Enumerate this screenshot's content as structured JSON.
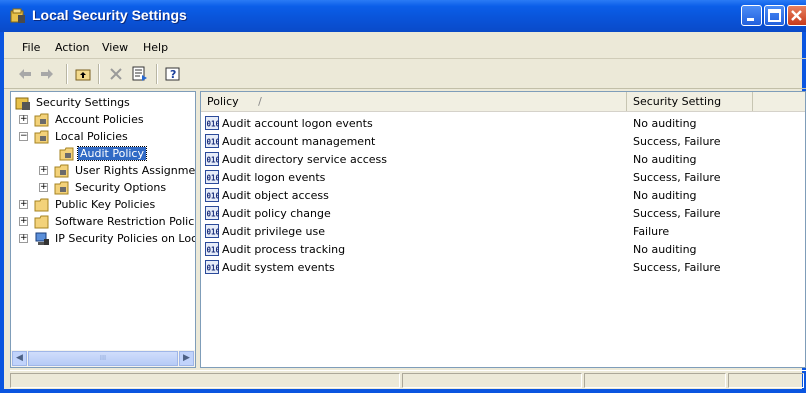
{
  "window": {
    "title": "Local Security Settings"
  },
  "menu": [
    "File",
    "Action",
    "View",
    "Help"
  ],
  "tree": {
    "root": "Security Settings",
    "items": [
      {
        "label": "Account Policies",
        "expander": "+"
      },
      {
        "label": "Local Policies",
        "expander": "−"
      },
      {
        "label": "Audit Policy",
        "expander": ""
      },
      {
        "label": "User Rights Assignmen",
        "expander": "+"
      },
      {
        "label": "Security Options",
        "expander": "+"
      },
      {
        "label": "Public Key Policies",
        "expander": "+"
      },
      {
        "label": "Software Restriction Policie",
        "expander": "+"
      },
      {
        "label": "IP Security Policies on Loca",
        "expander": "+"
      }
    ],
    "scroll_glyph": "III"
  },
  "list": {
    "columns": {
      "policy": "Policy",
      "sort_mark": "/",
      "setting": "Security Setting"
    },
    "rows": [
      {
        "policy": "Audit account logon events",
        "setting": "No auditing"
      },
      {
        "policy": "Audit account management",
        "setting": "Success, Failure"
      },
      {
        "policy": "Audit directory service access",
        "setting": "No auditing"
      },
      {
        "policy": "Audit logon events",
        "setting": "Success, Failure"
      },
      {
        "policy": "Audit object access",
        "setting": "No auditing"
      },
      {
        "policy": "Audit policy change",
        "setting": "Success, Failure"
      },
      {
        "policy": "Audit privilege use",
        "setting": "Failure"
      },
      {
        "policy": "Audit process tracking",
        "setting": "No auditing"
      },
      {
        "policy": "Audit system events",
        "setting": "Success, Failure"
      }
    ]
  },
  "colors": {
    "titlebar": "#0A53D8",
    "selection": "#316AC5",
    "chrome": "#ECE9D8"
  }
}
